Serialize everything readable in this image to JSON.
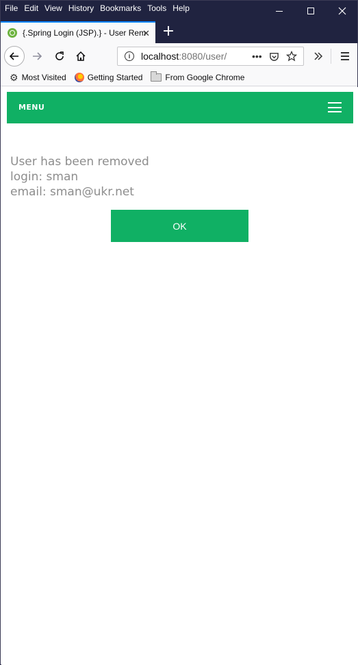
{
  "menubar": {
    "items": [
      "File",
      "Edit",
      "View",
      "History",
      "Bookmarks",
      "Tools",
      "Help"
    ]
  },
  "tab": {
    "title": "{.Spring Login (JSP).} - User Rem",
    "close_glyph": "✕",
    "new_tab_glyph": "+"
  },
  "navigation": {
    "url_host": "localhost",
    "url_rest": ":8080/user/",
    "more_glyph": "•••"
  },
  "bookmarks": {
    "items": [
      {
        "label": "Most Visited",
        "icon": "gear-icon"
      },
      {
        "label": "Getting Started",
        "icon": "firefox-icon"
      },
      {
        "label": "From Google Chrome",
        "icon": "folder-icon"
      }
    ]
  },
  "page": {
    "menu_label": "MENU",
    "message_line1": "User has been removed",
    "message_line2": "login: sman",
    "message_line3": "email: sman@ukr.net",
    "ok_label": "OK"
  },
  "colors": {
    "accent": "#10b064",
    "titlebar": "#202340",
    "message_text": "#8d8d8d"
  }
}
